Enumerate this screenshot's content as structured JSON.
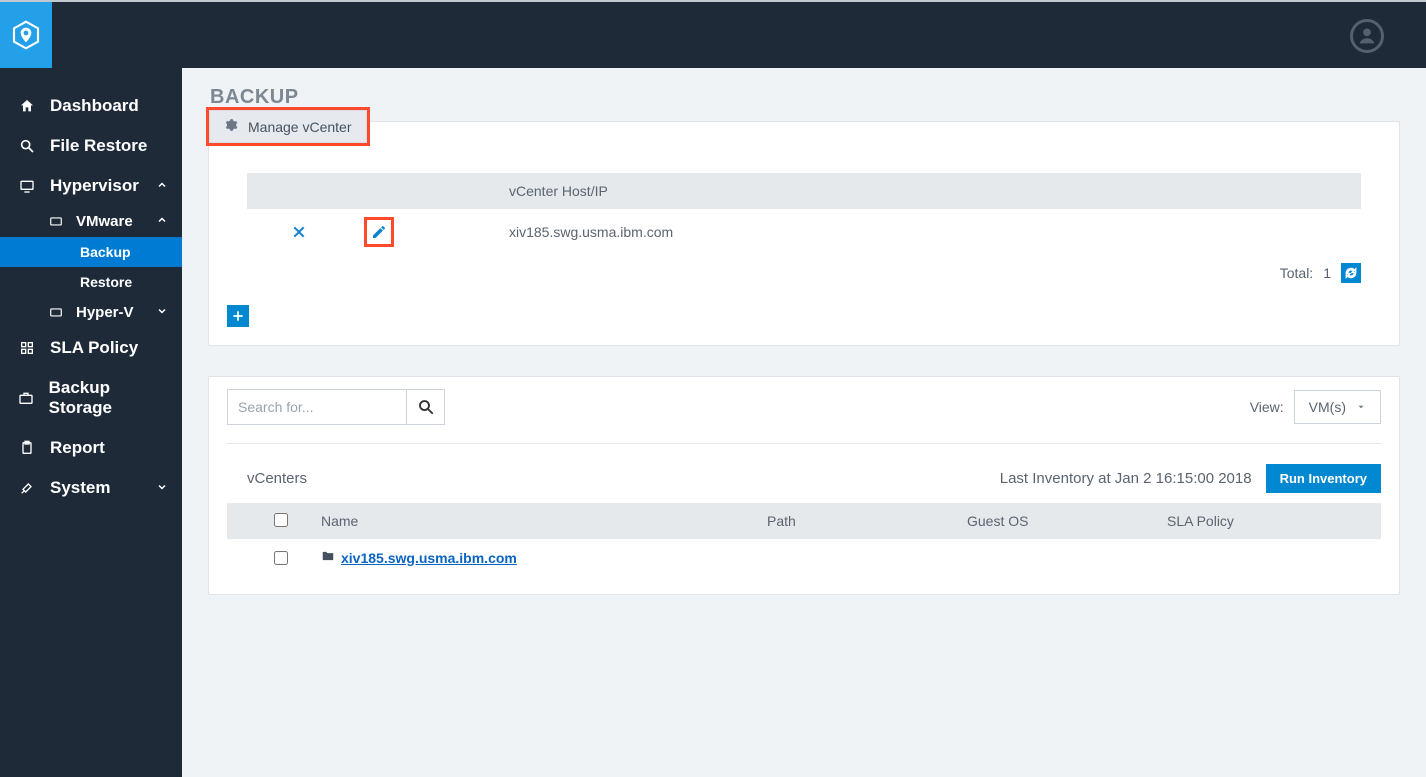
{
  "sidebar": {
    "items": [
      {
        "label": "Dashboard"
      },
      {
        "label": "File Restore"
      },
      {
        "label": "Hypervisor",
        "children": [
          {
            "label": "VMware",
            "children": [
              {
                "label": "Backup",
                "active": true
              },
              {
                "label": "Restore"
              }
            ]
          },
          {
            "label": "Hyper-V"
          }
        ]
      },
      {
        "label": "SLA Policy"
      },
      {
        "label": "Backup Storage"
      },
      {
        "label": "Report"
      },
      {
        "label": "System"
      }
    ]
  },
  "page": {
    "title": "BACKUP",
    "manage_button": "Manage vCenter",
    "vcenter_table": {
      "header": "vCenter Host/IP",
      "rows": [
        {
          "host": "xiv185.swg.usma.ibm.com"
        }
      ],
      "total_label": "Total:",
      "total_value": "1"
    },
    "search": {
      "placeholder": "Search for..."
    },
    "view": {
      "label": "View:",
      "selected": "VM(s)"
    },
    "inventory": {
      "section_label": "vCenters",
      "status": "Last Inventory at Jan 2 16:15:00 2018",
      "run_button": "Run Inventory",
      "columns": {
        "name": "Name",
        "path": "Path",
        "guest": "Guest OS",
        "sla": "SLA Policy"
      },
      "rows": [
        {
          "name": "xiv185.swg.usma.ibm.com"
        }
      ]
    }
  }
}
